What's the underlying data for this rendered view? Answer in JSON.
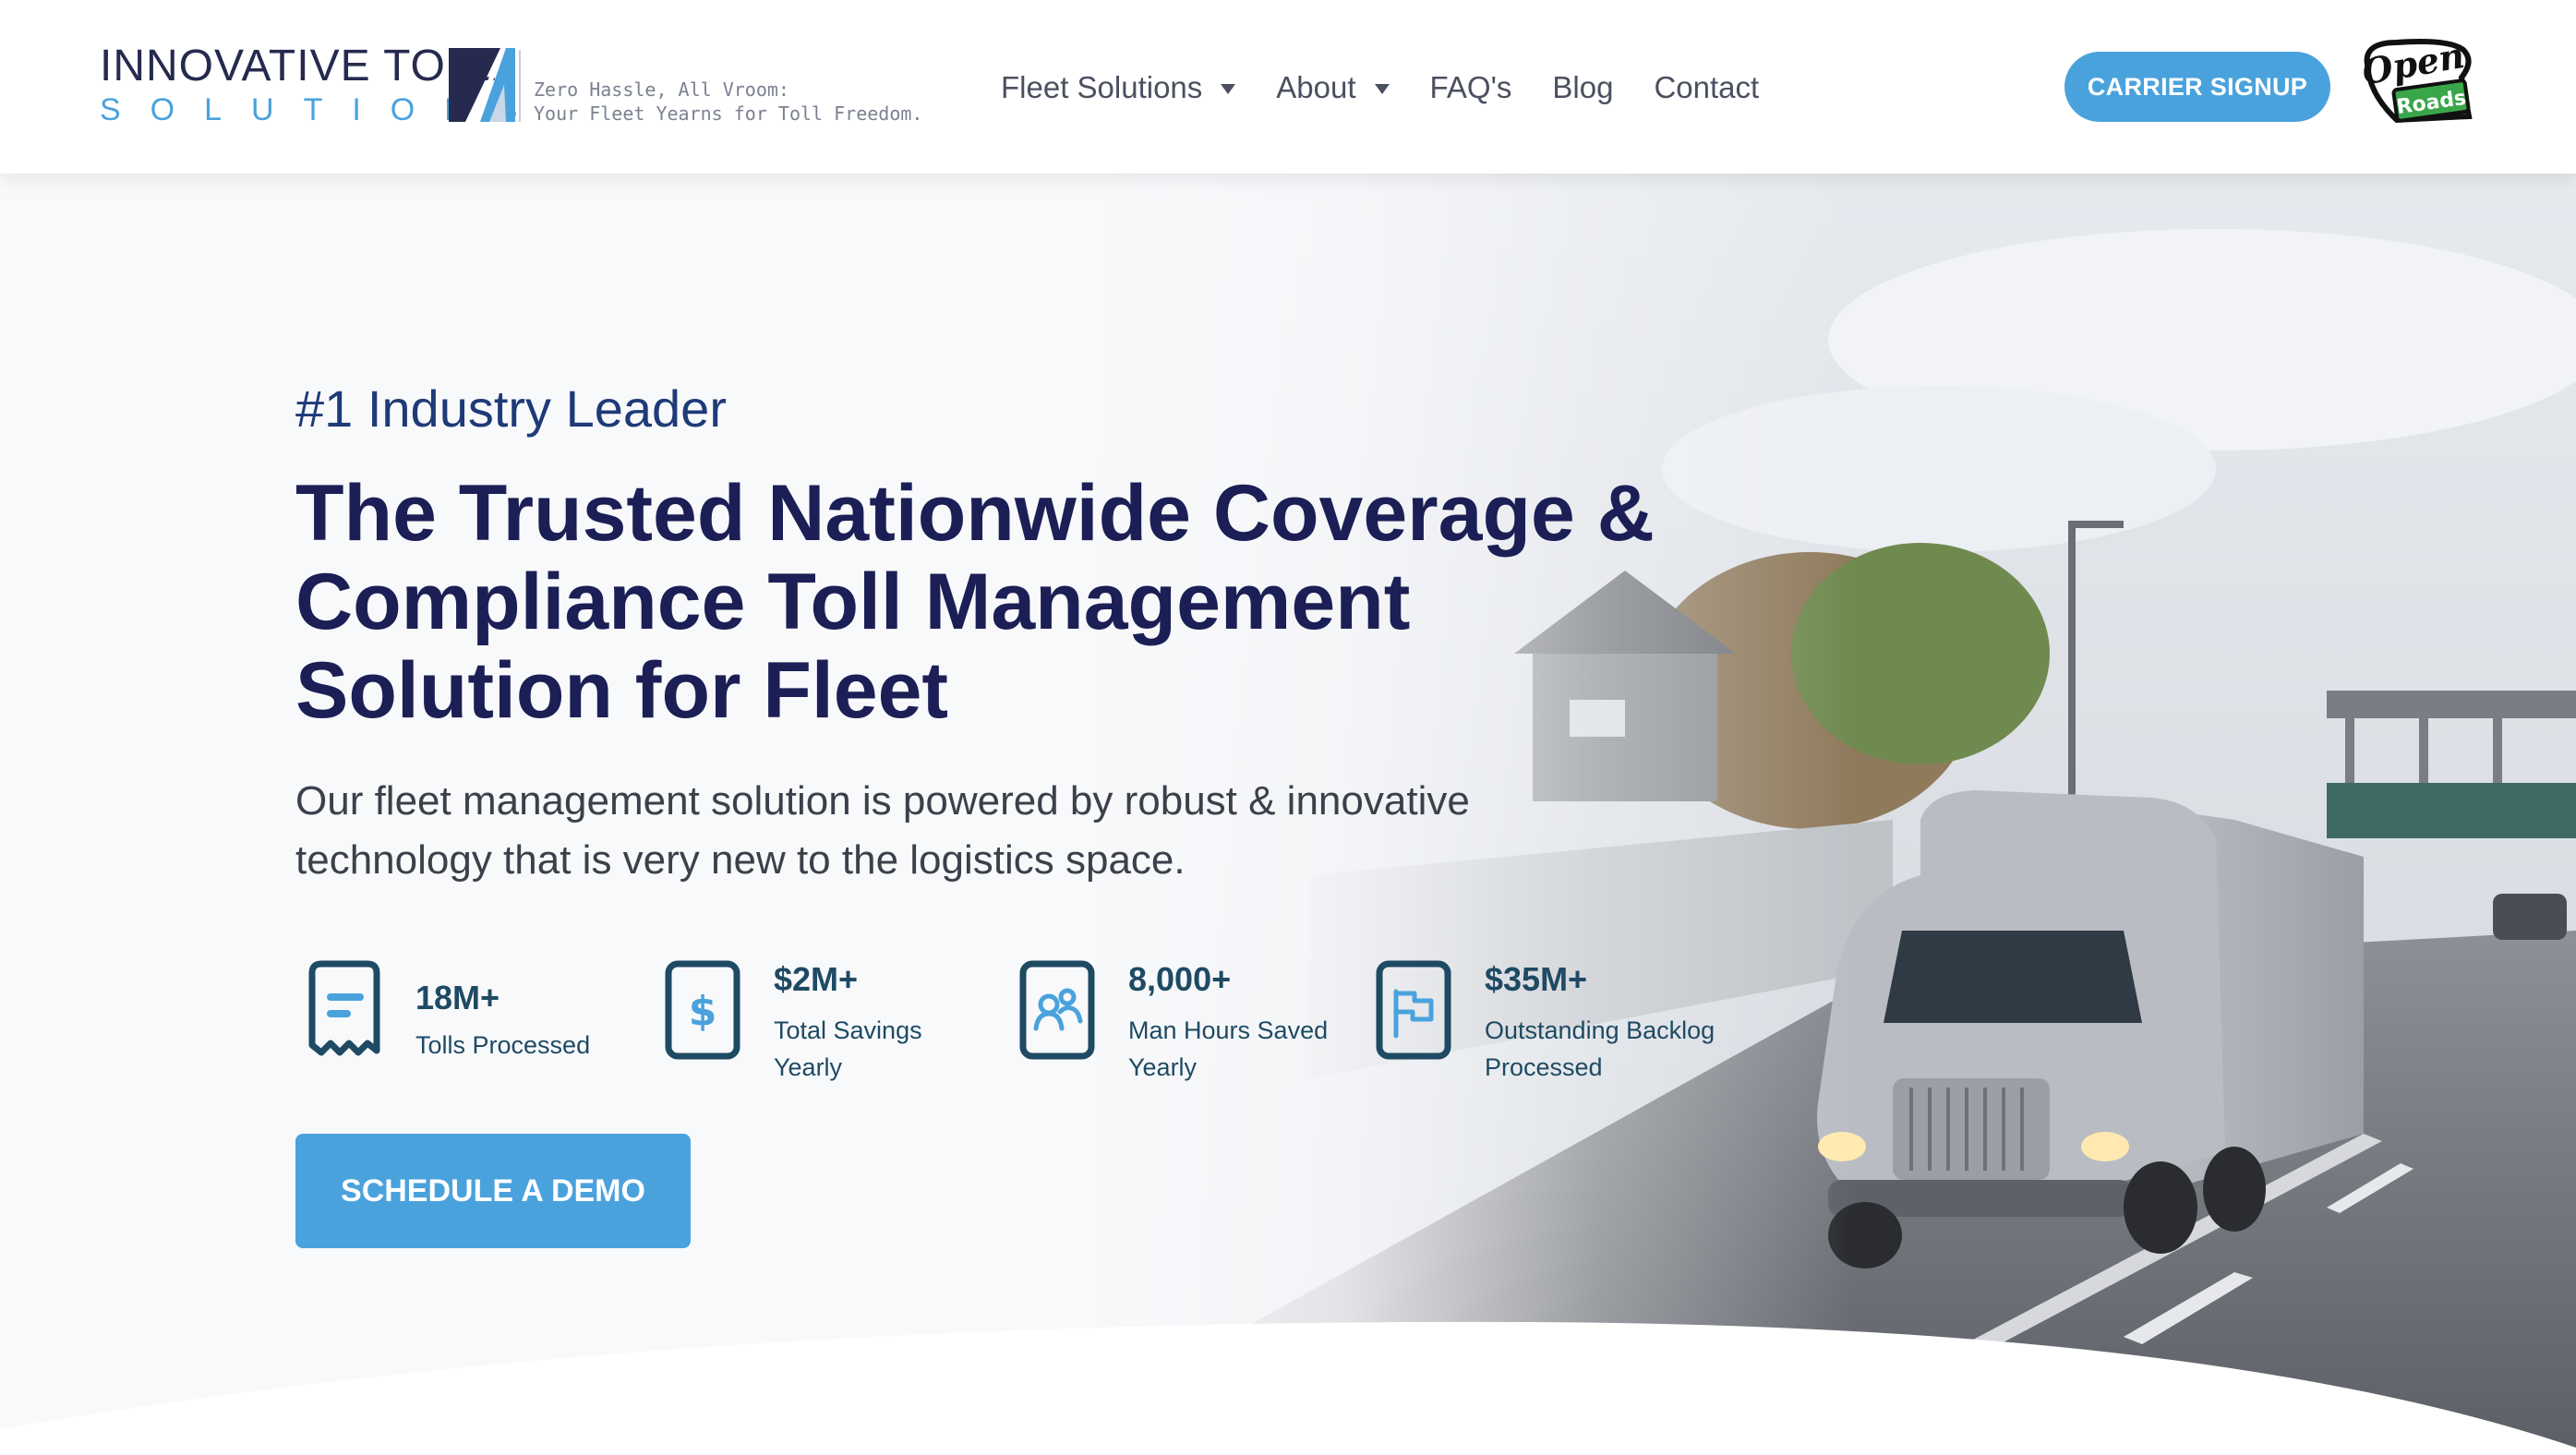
{
  "header": {
    "logo": {
      "line1": "INNOVATIVE TOLL",
      "line2": "SOLUTIONS",
      "tagline_line1": "Zero Hassle, All Vroom:",
      "tagline_line2": "Your Fleet Yearns for Toll Freedom."
    },
    "nav": [
      {
        "label": "Fleet Solutions",
        "has_dropdown": true
      },
      {
        "label": "About",
        "has_dropdown": true
      },
      {
        "label": "FAQ's",
        "has_dropdown": false
      },
      {
        "label": "Blog",
        "has_dropdown": false
      },
      {
        "label": "Contact",
        "has_dropdown": false
      }
    ],
    "carrier_signup_label": "CARRIER SIGNUP",
    "partner_logo": {
      "word1": "Open",
      "word2": "Roads"
    }
  },
  "hero": {
    "eyebrow": "#1 Industry Leader",
    "headline": "The Trusted Nationwide Coverage & Compliance Toll Management Solution for Fleet",
    "subtext": "Our fleet management solution is powered by robust & innovative technology that is very new to the logistics space.",
    "stats": [
      {
        "icon": "receipt-icon",
        "value": "18M+",
        "label": "Tolls Processed"
      },
      {
        "icon": "dollar-icon",
        "value": "$2M+",
        "label": "Total Savings Yearly"
      },
      {
        "icon": "people-icon",
        "value": "8,000+",
        "label": "Man Hours Saved Yearly"
      },
      {
        "icon": "flag-icon",
        "value": "$35M+",
        "label": "Outstanding Backlog Processed"
      }
    ],
    "cta_label": "SCHEDULE A DEMO"
  },
  "colors": {
    "accent": "#4aa2dd",
    "headline": "#1c1f55",
    "eyebrow": "#1e3a78",
    "stat_text": "#1e4a63"
  }
}
